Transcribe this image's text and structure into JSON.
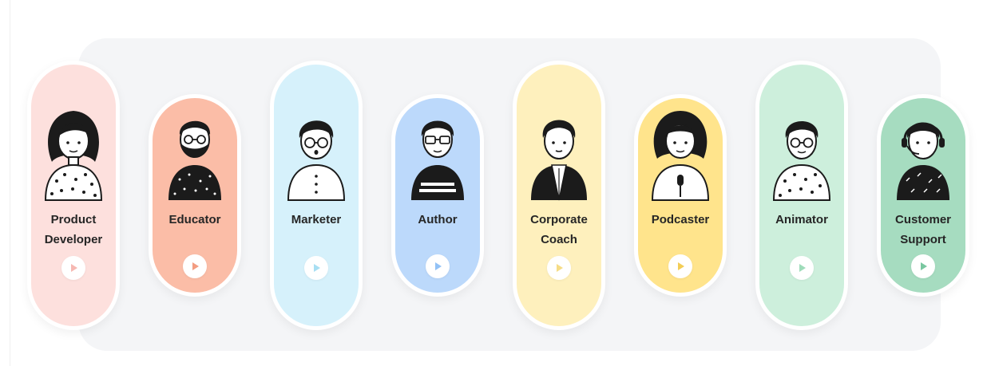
{
  "cards": [
    {
      "label": "Product\nDeveloper",
      "color": "#fde0dd",
      "size": "tall",
      "accent": "#f6b8b2"
    },
    {
      "label": "Educator",
      "color": "#fbbda7",
      "size": "short",
      "accent": "#f39c81"
    },
    {
      "label": "Marketer",
      "color": "#d6f1fb",
      "size": "tall",
      "accent": "#a8dff3"
    },
    {
      "label": "Author",
      "color": "#bcd9fb",
      "size": "short",
      "accent": "#93c2f6"
    },
    {
      "label": "Corporate\nCoach",
      "color": "#fef0bd",
      "size": "tall",
      "accent": "#f6dc86"
    },
    {
      "label": "Podcaster",
      "color": "#ffe48c",
      "size": "short",
      "accent": "#f3cd56"
    },
    {
      "label": "Animator",
      "color": "#cdefdc",
      "size": "tall",
      "accent": "#9fdcba"
    },
    {
      "label": "Customer\nSupport",
      "color": "#a6dcc0",
      "size": "short",
      "accent": "#79c7a0"
    }
  ],
  "icons": {
    "avatar": "person-avatar-icon",
    "play": "play-icon"
  }
}
